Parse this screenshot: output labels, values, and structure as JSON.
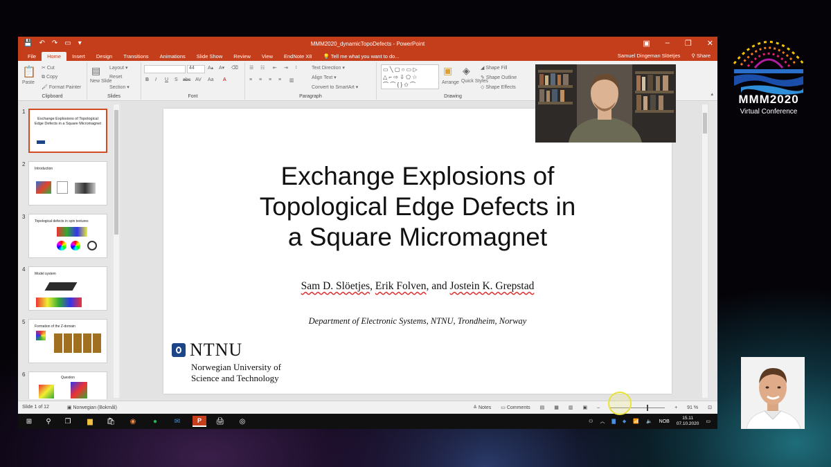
{
  "conference": {
    "title": "MMM2020",
    "subtitle": "Virtual Conference"
  },
  "app": {
    "window_title": "MMM2020_dynamicTopoDefects - PowerPoint",
    "user": "Samuel Dingeman Slöetjes",
    "share": "Share",
    "tabs": [
      "File",
      "Home",
      "Insert",
      "Design",
      "Transitions",
      "Animations",
      "Slide Show",
      "Review",
      "View",
      "EndNote X8"
    ],
    "active_tab": "Home",
    "tell_me": "Tell me what you want to do..."
  },
  "ribbon": {
    "clipboard": {
      "label": "Clipboard",
      "paste": "Paste",
      "cut": "Cut",
      "copy": "Copy",
      "format_painter": "Format Painter"
    },
    "slides": {
      "label": "Slides",
      "new_slide": "New Slide",
      "layout": "Layout",
      "reset": "Reset",
      "section": "Section"
    },
    "font": {
      "label": "Font",
      "size": "44"
    },
    "paragraph": {
      "label": "Paragraph",
      "text_direction": "Text Direction",
      "align_text": "Align Text",
      "smartart": "Convert to SmartArt"
    },
    "drawing": {
      "label": "Drawing",
      "arrange": "Arrange",
      "quick_styles": "Quick Styles",
      "shape_fill": "Shape Fill",
      "shape_outline": "Shape Outline",
      "shape_effects": "Shape Effects"
    }
  },
  "thumbnails": [
    {
      "num": "1",
      "title": "Exchange Explosions of Topological Edge Defects in a Square Micromagnet",
      "selected": true
    },
    {
      "num": "2",
      "title": "Introduction",
      "selected": false
    },
    {
      "num": "3",
      "title": "Topological defects in spin textures",
      "selected": false
    },
    {
      "num": "4",
      "title": "Model system",
      "selected": false
    },
    {
      "num": "5",
      "title": "Formation of the Z-domain",
      "selected": false
    },
    {
      "num": "6",
      "title": "Question",
      "selected": false
    }
  ],
  "slide": {
    "title_lines": [
      "Exchange Explosions of",
      "Topological Edge Defects in",
      "a Square Micromagnet"
    ],
    "authors": {
      "a1": "Sam D. Slöetjes",
      "a2": "Erik Folven",
      "a3": "Jostein K. Grepstad",
      "sep1": ", ",
      "sep2": ", and "
    },
    "department": "Department of Electronic Systems, NTNU, Trondheim, Norway",
    "logo_word": "NTNU",
    "logo_sub1": "Norwegian University of",
    "logo_sub2": "Science and Technology"
  },
  "status": {
    "slide_of": "Slide 1 of 12",
    "language": "Norwegian (Bokmål)",
    "notes": "Notes",
    "comments": "Comments",
    "zoom": "91 %"
  },
  "taskbar": {
    "lang": "NOB",
    "time": "15.11",
    "date": "07.10.2020"
  }
}
